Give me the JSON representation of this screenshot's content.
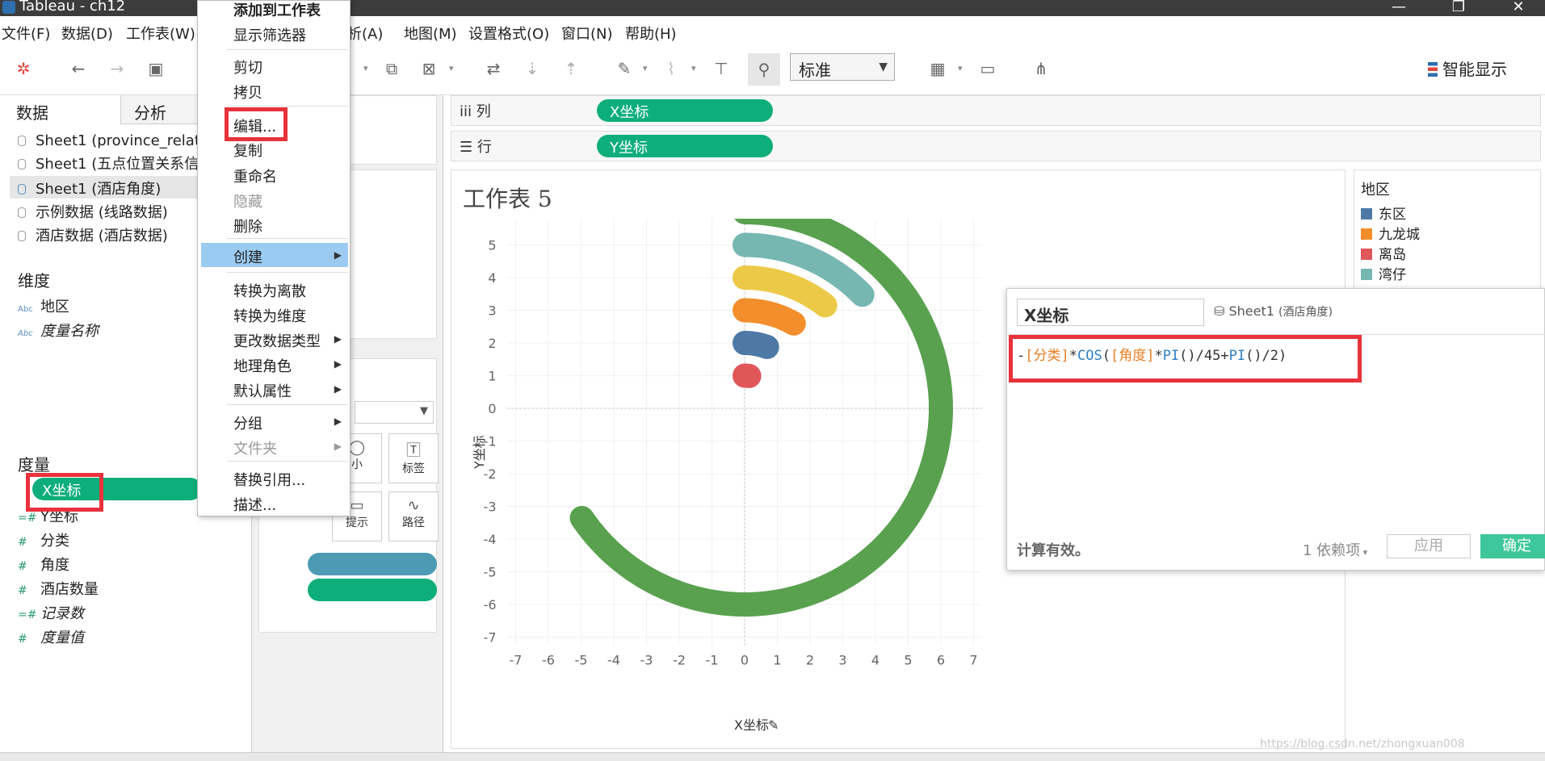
{
  "window": {
    "title": "Tableau - ch12",
    "minimize": "—",
    "restore": "❐",
    "close": "✕"
  },
  "menubar": [
    {
      "label": "文件(F)"
    },
    {
      "label": "数据(D)"
    },
    {
      "label": "工作表(W)"
    },
    {
      "label": "分析(A)"
    },
    {
      "label": "地图(M)"
    },
    {
      "label": "设置格式(O)"
    },
    {
      "label": "窗口(N)"
    },
    {
      "label": "帮助(H)"
    }
  ],
  "toolbar": {
    "view_mode": "标准",
    "smart_show": "智能显示"
  },
  "left_pane": {
    "tabs": {
      "data": "数据",
      "analysis": "分析"
    },
    "sources": [
      {
        "label": "Sheet1 (province_relati"
      },
      {
        "label": "Sheet1 (五点位置关系信"
      },
      {
        "label": "Sheet1 (酒店角度)"
      },
      {
        "label": "示例数据 (线路数据)"
      },
      {
        "label": "酒店数据 (酒店数据)"
      }
    ],
    "dimensions_header": "维度",
    "dimensions": [
      {
        "icon": "Abc",
        "label": "地区"
      },
      {
        "icon": "Abc",
        "label": "度量名称"
      }
    ],
    "measures_header": "度量",
    "measures": [
      {
        "label": "X坐标"
      },
      {
        "label": "Y坐标"
      },
      {
        "label": "分类"
      },
      {
        "label": "角度"
      },
      {
        "label": "酒店数量"
      },
      {
        "label": "记录数"
      },
      {
        "label": "度量值"
      }
    ]
  },
  "marks_card": {
    "size_label": "小",
    "label_label": "标签",
    "tooltip_label": "提示",
    "path_label": "路径"
  },
  "shelves": {
    "columns": {
      "label": "列",
      "pill": "X坐标"
    },
    "rows": {
      "label": "行",
      "pill": "Y坐标"
    }
  },
  "sheet": {
    "title": "工作表 5"
  },
  "chart_data": {
    "type": "line",
    "xlabel": "X坐标",
    "ylabel": "Y坐标",
    "xlim": [
      -7,
      7
    ],
    "ylim": [
      -7,
      7
    ],
    "xticks": [
      -7,
      -6,
      -5,
      -4,
      -3,
      -2,
      -1,
      0,
      1,
      2,
      3,
      4,
      5,
      6,
      7
    ],
    "yticks": [
      7,
      6,
      5,
      4,
      3,
      2,
      1,
      0,
      -1,
      -2,
      -3,
      -4,
      -5,
      -6,
      -7
    ],
    "grid": true,
    "legend_position": "right",
    "series": [
      {
        "name": "离岛",
        "color": "#e15759",
        "radius": 1,
        "start_deg": 0,
        "end_deg": 8
      },
      {
        "name": "东区",
        "color": "#4e79a7",
        "radius": 2,
        "start_deg": 0,
        "end_deg": 20
      },
      {
        "name": "九龙城",
        "color": "#f28e2b",
        "radius": 3,
        "start_deg": 0,
        "end_deg": 30
      },
      {
        "name": "",
        "color": "#edc948",
        "radius": 4,
        "start_deg": 0,
        "end_deg": 38
      },
      {
        "name": "湾仔",
        "color": "#76b7b2",
        "radius": 5,
        "start_deg": 0,
        "end_deg": 46
      },
      {
        "name": "",
        "color": "#59a14f",
        "radius": 6,
        "start_deg": 0,
        "end_deg": 236
      }
    ]
  },
  "legend": {
    "title": "地区",
    "items": [
      {
        "label": "东区",
        "color": "#4e79a7"
      },
      {
        "label": "九龙城",
        "color": "#f28e2b"
      },
      {
        "label": "离岛",
        "color": "#e15759"
      },
      {
        "label": "湾仔",
        "color": "#76b7b2"
      }
    ]
  },
  "calc_editor": {
    "name": "X坐标",
    "source": "Sheet1",
    "source_sub": "(酒店角度)",
    "formula": [
      {
        "t": "op",
        "v": "-"
      },
      {
        "t": "fld",
        "v": "[分类]"
      },
      {
        "t": "op",
        "v": "*"
      },
      {
        "t": "fn",
        "v": "COS"
      },
      {
        "t": "op",
        "v": "("
      },
      {
        "t": "fld",
        "v": "[角度]"
      },
      {
        "t": "op",
        "v": "*"
      },
      {
        "t": "fn",
        "v": "PI"
      },
      {
        "t": "op",
        "v": "()/45+"
      },
      {
        "t": "fn",
        "v": "PI"
      },
      {
        "t": "op",
        "v": "()/2)"
      }
    ],
    "status": "计算有效。",
    "dependents": "1 依赖项",
    "apply": "应用",
    "ok": "确定"
  },
  "context_menu": {
    "items": [
      {
        "label": "添加到工作表",
        "bold": true
      },
      {
        "label": "显示筛选器"
      },
      {
        "label": "剪切"
      },
      {
        "label": "拷贝"
      },
      {
        "label": "编辑..."
      },
      {
        "label": "复制"
      },
      {
        "label": "重命名"
      },
      {
        "label": "隐藏",
        "disabled": true
      },
      {
        "label": "删除"
      },
      {
        "label": "创建",
        "submenu": true,
        "highlight": true
      },
      {
        "label": "转换为离散"
      },
      {
        "label": "转换为维度"
      },
      {
        "label": "更改数据类型",
        "submenu": true
      },
      {
        "label": "地理角色",
        "submenu": true
      },
      {
        "label": "默认属性",
        "submenu": true
      },
      {
        "label": "分组",
        "submenu": true
      },
      {
        "label": "文件夹",
        "submenu": true,
        "disabled": true
      },
      {
        "label": "替换引用..."
      },
      {
        "label": "描述..."
      }
    ]
  },
  "watermark": "https://blog.csdn.net/zhongxuan008"
}
